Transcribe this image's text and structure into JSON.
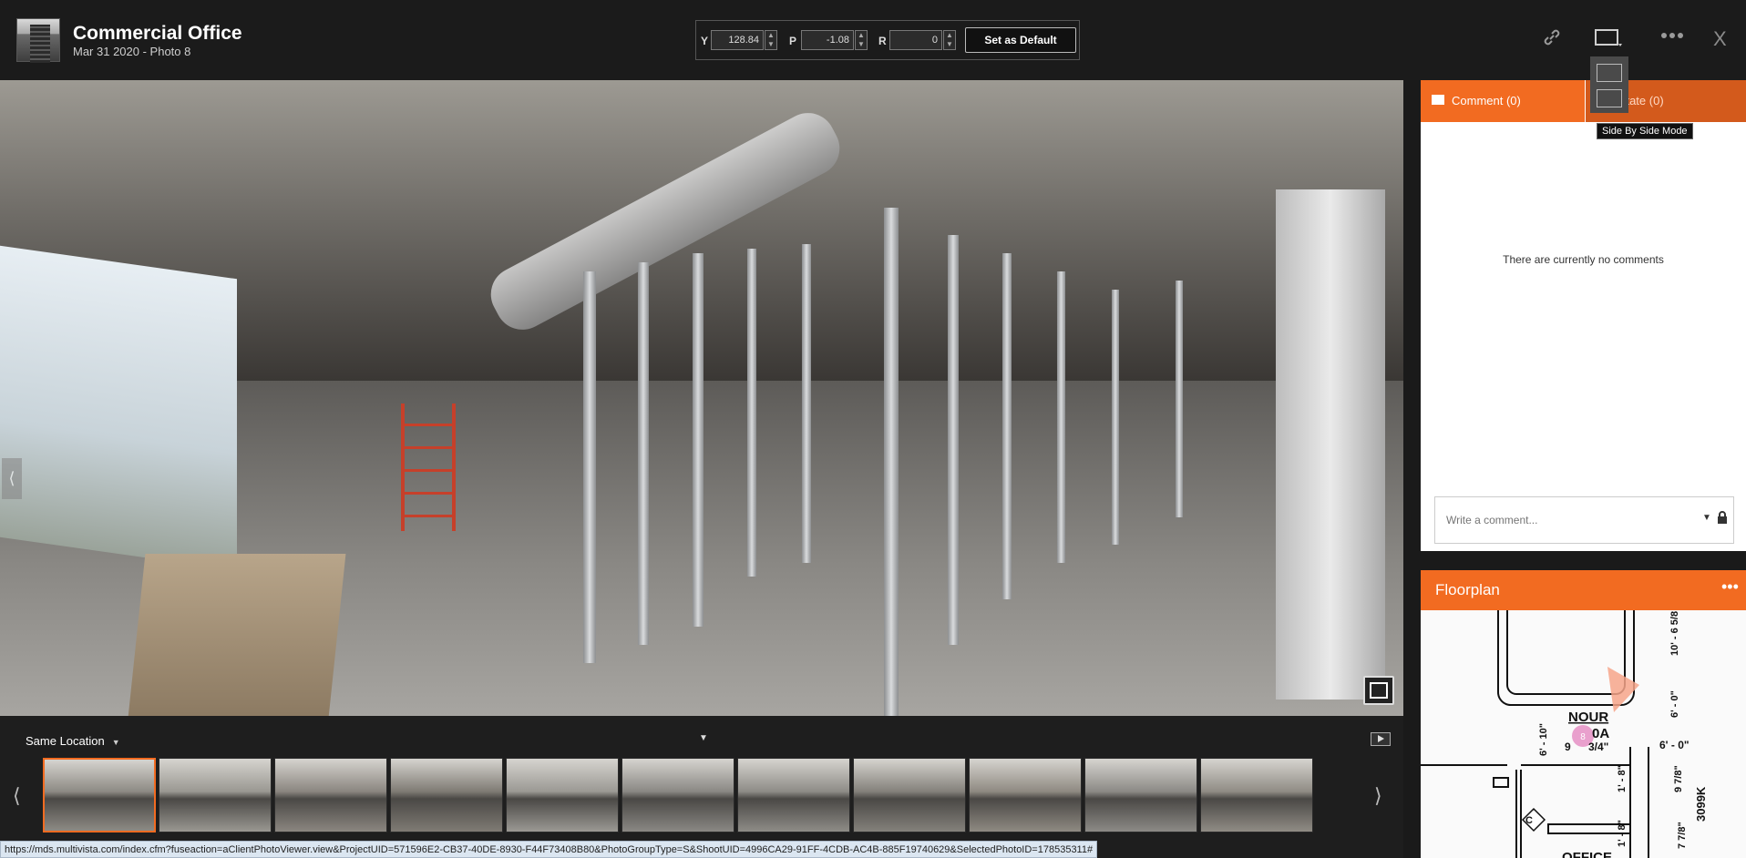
{
  "header": {
    "title": "Commercial Office",
    "subtitle": "Mar 31 2020 - Photo 8",
    "icons": [
      "link-icon",
      "view-mode-icon",
      "more-icon"
    ],
    "close_label": "X"
  },
  "ypr": {
    "y_label": "Y",
    "y_value": "128.84",
    "p_label": "P",
    "p_value": "-1.08",
    "r_label": "R",
    "r_value": "0",
    "set_default_label": "Set as Default"
  },
  "view_mode_tooltip": "Side By Side Mode",
  "comments": {
    "tab_comment": "Comment (0)",
    "tab_annotate": "notate (0)",
    "empty_text": "There are currently no comments",
    "input_placeholder": "Write a comment..."
  },
  "floorplan": {
    "title": "Floorplan",
    "labels": [
      "NOUR",
      "0A",
      "9",
      "3/4\"",
      "6' - 10\"",
      "6' - 0\"",
      "10' - 6 5/8",
      "6' - 0\"",
      "1' - 8\"",
      "1' - 8\"",
      "9 7/8\"",
      "3099K",
      "7 7/8\"",
      "OFFICE",
      "C"
    ],
    "pin_number": "8"
  },
  "filmstrip": {
    "filter_label": "Same Location",
    "thumbnail_count": 11,
    "selected_index": 0
  },
  "status_url": "https://mds.multivista.com/index.cfm?fuseaction=aClientPhotoViewer.view&ProjectUID=571596E2-CB37-40DE-8930-F44F73408B80&PhotoGroupType=S&ShootUID=4996CA29-91FF-4CDB-AC4B-885F19740629&SelectedPhotoID=178535311#",
  "colors": {
    "accent": "#f26b21",
    "background": "#1b1b1b"
  }
}
